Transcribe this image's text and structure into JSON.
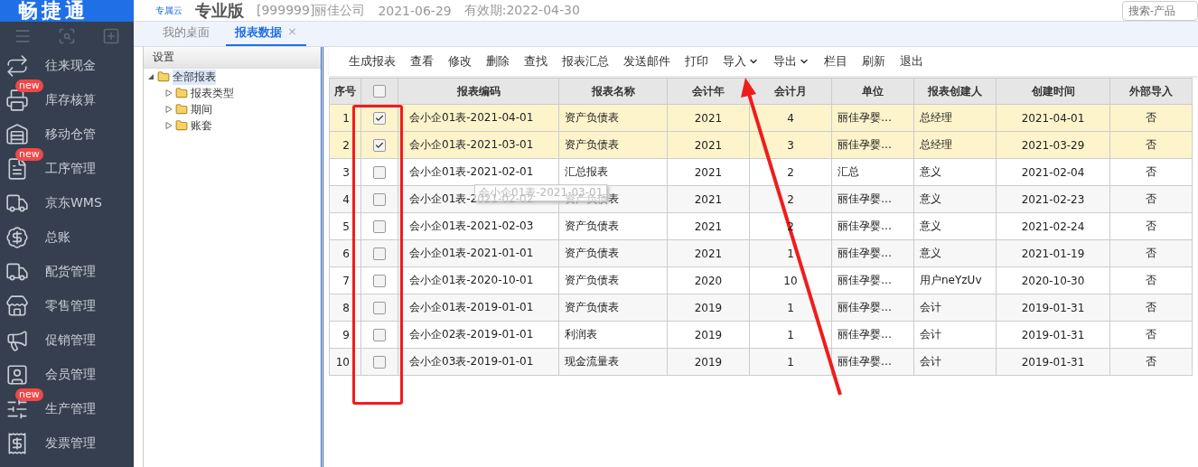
{
  "header": {
    "logo": "畅捷通",
    "brand_tag": "专属云",
    "edition": "专业版",
    "company": "[999999]丽佳公司",
    "date": "2021-06-29",
    "validity": "有效期:2022-04-30",
    "search": {
      "placeholder": "搜索-产品"
    }
  },
  "sidebar": {
    "items": [
      {
        "label": "往来现金"
      },
      {
        "label": "库存核算",
        "badge": "new"
      },
      {
        "label": "移动仓管"
      },
      {
        "label": "工序管理",
        "badge": "new"
      },
      {
        "label": "京东WMS"
      },
      {
        "label": "总账"
      },
      {
        "label": "配货管理"
      },
      {
        "label": "零售管理"
      },
      {
        "label": "促销管理"
      },
      {
        "label": "会员管理"
      },
      {
        "label": "生产管理",
        "badge": "new"
      },
      {
        "label": "发票管理"
      }
    ]
  },
  "tabs": [
    {
      "label": "我的桌面",
      "selected": false,
      "closable": false
    },
    {
      "label": "报表数据",
      "selected": true,
      "closable": true,
      "close": "×"
    }
  ],
  "tree": {
    "title": "设置",
    "root": {
      "label": "全部报表",
      "expanded": true,
      "selected": true,
      "children": [
        {
          "label": "报表类型",
          "expanded": false,
          "selected": false
        },
        {
          "label": "期间",
          "expanded": false,
          "selected": false
        },
        {
          "label": "账套",
          "expanded": false,
          "selected": false
        }
      ]
    }
  },
  "toolbar": [
    {
      "label": "生成报表",
      "dropdown": false
    },
    {
      "label": "查看",
      "dropdown": false
    },
    {
      "label": "修改",
      "dropdown": false
    },
    {
      "label": "删除",
      "dropdown": false
    },
    {
      "label": "查找",
      "dropdown": false
    },
    {
      "label": "报表汇总",
      "dropdown": false
    },
    {
      "label": "发送邮件",
      "dropdown": false
    },
    {
      "label": "打印",
      "dropdown": false
    },
    {
      "label": "导入",
      "dropdown": true
    },
    {
      "label": "导出",
      "dropdown": true
    },
    {
      "label": "栏目",
      "dropdown": false
    },
    {
      "label": "刷新",
      "dropdown": false
    },
    {
      "label": "退出",
      "dropdown": false
    }
  ],
  "table": {
    "columns": [
      "序号",
      "",
      "报表编码",
      "报表名称",
      "会计年",
      "会计月",
      "单位",
      "报表创建人",
      "创建时间",
      "外部导入"
    ],
    "all_checked": false,
    "rows": [
      {
        "cells": [
          "1",
          "",
          "会小企01表-2021-04-01",
          "资产负债表",
          "2021",
          "4",
          "丽佳孕婴…",
          "总经理",
          "2021-04-01",
          "否"
        ],
        "checked": true
      },
      {
        "cells": [
          "2",
          "",
          "会小企01表-2021-03-01",
          "资产负债表",
          "2021",
          "3",
          "丽佳孕婴…",
          "总经理",
          "2021-03-29",
          "否"
        ],
        "checked": true
      },
      {
        "cells": [
          "3",
          "",
          "会小企01表-2021-02-01",
          "汇总报表",
          "2021",
          "2",
          "汇总",
          "意义",
          "2021-02-04",
          "否"
        ],
        "checked": false
      },
      {
        "cells": [
          "4",
          "",
          "会小企01表-2021-02-02",
          "资产负债表",
          "2021",
          "2",
          "丽佳孕婴…",
          "意义",
          "2021-02-23",
          "否"
        ],
        "checked": false
      },
      {
        "cells": [
          "5",
          "",
          "会小企01表-2021-02-03",
          "资产负债表",
          "2021",
          "2",
          "丽佳孕婴…",
          "意义",
          "2021-02-24",
          "否"
        ],
        "checked": false
      },
      {
        "cells": [
          "6",
          "",
          "会小企01表-2021-01-01",
          "资产负债表",
          "2021",
          "1",
          "丽佳孕婴…",
          "意义",
          "2021-01-19",
          "否"
        ],
        "checked": false
      },
      {
        "cells": [
          "7",
          "",
          "会小企01表-2020-10-01",
          "资产负债表",
          "2020",
          "10",
          "丽佳孕婴…",
          "用户neYzUv",
          "2020-10-30",
          "否"
        ],
        "checked": false
      },
      {
        "cells": [
          "8",
          "",
          "会小企01表-2019-01-01",
          "资产负债表",
          "2019",
          "1",
          "丽佳孕婴…",
          "会计",
          "2019-01-31",
          "否"
        ],
        "checked": false
      },
      {
        "cells": [
          "9",
          "",
          "会小企02表-2019-01-01",
          "利润表",
          "2019",
          "1",
          "丽佳孕婴…",
          "会计",
          "2019-01-31",
          "否"
        ],
        "checked": false
      },
      {
        "cells": [
          "10",
          "",
          "会小企03表-2019-01-01",
          "现金流量表",
          "2019",
          "1",
          "丽佳孕婴…",
          "会计",
          "2019-01-31",
          "否"
        ],
        "checked": false
      }
    ]
  },
  "drag_tooltip": "会小企01表-2021-03-01"
}
